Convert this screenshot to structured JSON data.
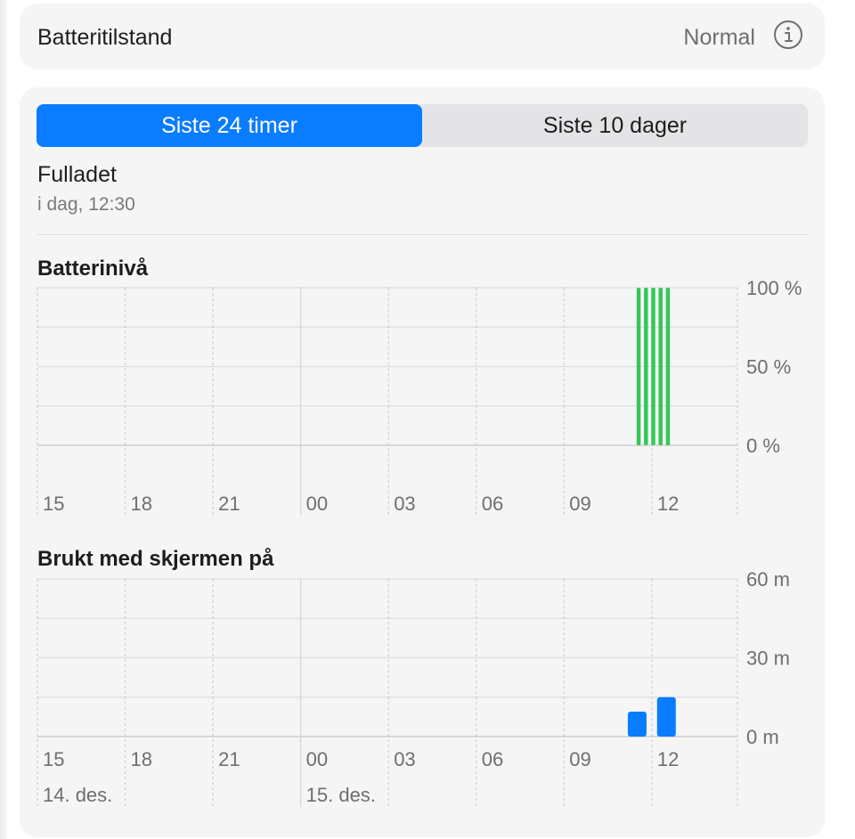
{
  "battery_health": {
    "label": "Batteritilstand",
    "value": "Normal",
    "icon": "info-icon"
  },
  "tabs": [
    {
      "label": "Siste 24 timer",
      "selected": true
    },
    {
      "label": "Siste 10 dager",
      "selected": false
    }
  ],
  "charge": {
    "status": "Fulladet",
    "time": "i dag, 12:30"
  },
  "colors": {
    "accent": "#0a7cff",
    "battery_bar": "#34c759",
    "screen_bar": "#0a7cff"
  },
  "chart_data": [
    {
      "type": "bar",
      "title": "Batterinivå",
      "x_tick_labels": [
        "15",
        "18",
        "21",
        "00",
        "03",
        "06",
        "09",
        "12"
      ],
      "y_tick_labels": [
        "100 %",
        "50 %",
        "0 %"
      ],
      "ylim": [
        0,
        100
      ],
      "x_hours": [
        15,
        18,
        21,
        24,
        27,
        30,
        33,
        36
      ],
      "bars": [
        {
          "hour": 35.55,
          "value": 100
        },
        {
          "hour": 35.8,
          "value": 100
        },
        {
          "hour": 36.05,
          "value": 100
        },
        {
          "hour": 36.3,
          "value": 100
        },
        {
          "hour": 36.55,
          "value": 100
        }
      ],
      "grid": true
    },
    {
      "type": "bar",
      "title": "Brukt med skjermen på",
      "x_tick_labels": [
        "15",
        "18",
        "21",
        "00",
        "03",
        "06",
        "09",
        "12"
      ],
      "y_tick_labels": [
        "60 m",
        "30 m",
        "0 m"
      ],
      "ylim": [
        0,
        60
      ],
      "x_hours": [
        15,
        18,
        21,
        24,
        27,
        30,
        33,
        36
      ],
      "bars": [
        {
          "hour": 35.5,
          "value": 9.5
        },
        {
          "hour": 36.5,
          "value": 15
        }
      ],
      "date_labels": [
        {
          "hour": 15,
          "label": "14. des."
        },
        {
          "hour": 24,
          "label": "15. des."
        }
      ],
      "grid": true
    }
  ]
}
